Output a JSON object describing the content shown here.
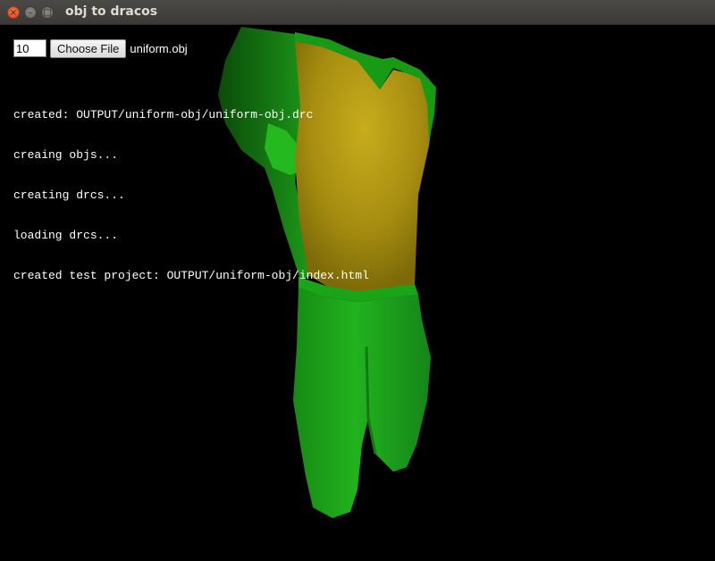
{
  "window": {
    "title": "obj to dracos",
    "close_glyph": "×",
    "minimize_glyph": "–",
    "maximize_glyph": "□"
  },
  "controls": {
    "quality_value": "10",
    "choose_file_label": "Choose File",
    "file_name": "uniform.obj"
  },
  "log": [
    "created: OUTPUT/uniform-obj/uniform-obj.drc",
    "creaing objs...",
    "creating drcs...",
    "loading drcs...",
    "created test project: OUTPUT/uniform-obj/index.html"
  ],
  "colors": {
    "background": "#000000",
    "jersey_green": "#1e9e1a",
    "jersey_yellow": "#b49a10",
    "pants_green": "#1fa61c"
  }
}
